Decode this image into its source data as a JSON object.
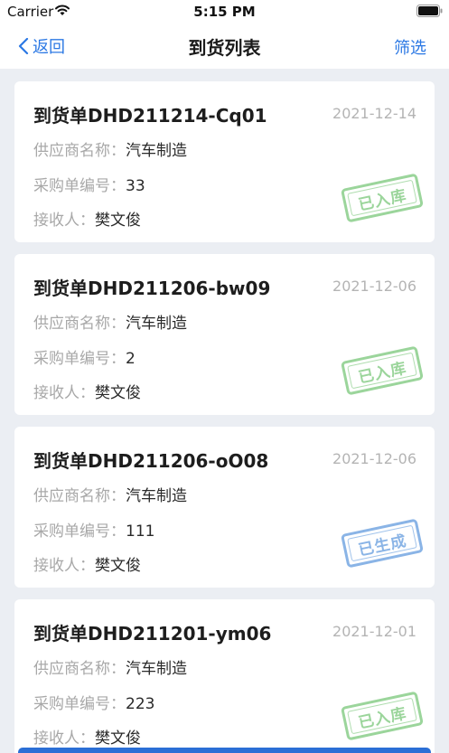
{
  "status_bar": {
    "carrier": "Carrier",
    "time": "5:15 PM"
  },
  "nav": {
    "back_label": "返回",
    "title": "到货列表",
    "filter_label": "筛选"
  },
  "labels": {
    "supplier": "供应商名称：",
    "po_number": "采购单编号：",
    "receiver": "接收人："
  },
  "colors": {
    "accent": "#2b78e4",
    "stamp_stored": "#9bd59b",
    "stamp_generated": "#8ab4e6"
  },
  "orders": [
    {
      "title": "到货单DHD211214-Cq01",
      "date": "2021-12-14",
      "supplier": "汽车制造",
      "po_number": "33",
      "receiver": "樊文俊",
      "status": "已入库"
    },
    {
      "title": "到货单DHD211206-bw09",
      "date": "2021-12-06",
      "supplier": "汽车制造",
      "po_number": "2",
      "receiver": "樊文俊",
      "status": "已入库"
    },
    {
      "title": "到货单DHD211206-oO08",
      "date": "2021-12-06",
      "supplier": "汽车制造",
      "po_number": "111",
      "receiver": "樊文俊",
      "status": "已生成"
    },
    {
      "title": "到货单DHD211201-ym06",
      "date": "2021-12-01",
      "supplier": "汽车制造",
      "po_number": "223",
      "receiver": "樊文俊",
      "status": "已入库"
    }
  ]
}
